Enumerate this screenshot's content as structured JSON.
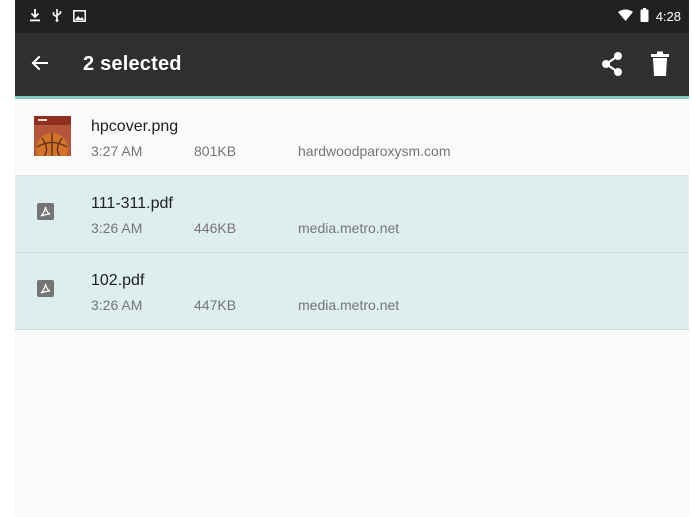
{
  "status": {
    "icons": [
      "download-icon",
      "usb-icon",
      "image-icon",
      "wifi-icon",
      "battery-icon"
    ],
    "time": "4:28"
  },
  "toolbar": {
    "back_icon": "arrow-left-icon",
    "title": "2 selected",
    "actions": [
      "share-icon",
      "delete-icon"
    ],
    "background": "#2f2f2f",
    "accent": "#80cbc4"
  },
  "downloads": [
    {
      "name": "hpcover.png",
      "time": "3:27 AM",
      "size": "801KB",
      "source": "hardwoodparoxysm.com",
      "icon": "image-thumbnail",
      "selected": false
    },
    {
      "name": "111-311.pdf",
      "time": "3:26 AM",
      "size": "446KB",
      "source": "media.metro.net",
      "icon": "pdf-icon",
      "selected": true
    },
    {
      "name": "102.pdf",
      "time": "3:26 AM",
      "size": "447KB",
      "source": "media.metro.net",
      "icon": "pdf-icon",
      "selected": true
    }
  ],
  "colors": {
    "selected_row": "#deeded",
    "secondary_text": "#757575"
  }
}
